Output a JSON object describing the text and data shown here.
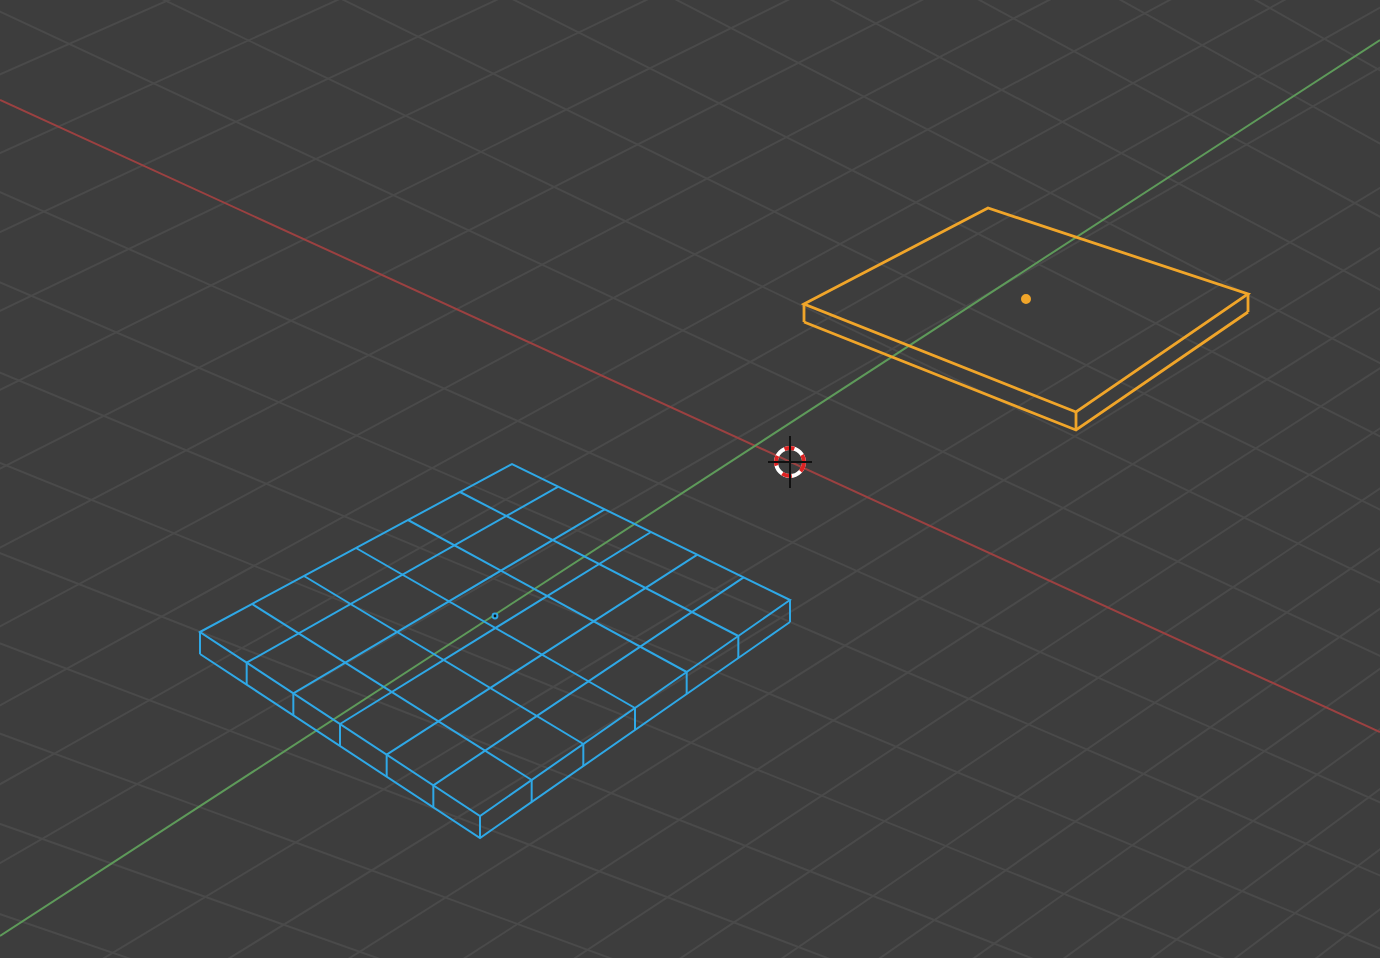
{
  "viewport": {
    "objects": [
      {
        "kind": "slab",
        "selected": true,
        "color": "#f0a52a"
      },
      {
        "kind": "grid-slab",
        "selected": false,
        "color": "#2fa8e6"
      }
    ]
  }
}
